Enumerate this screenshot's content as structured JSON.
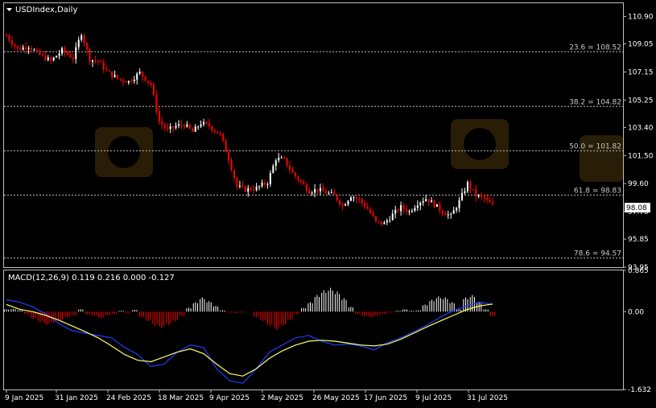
{
  "header": {
    "symbol_label": "USDIndex,Daily",
    "macd_label": "MACD(12,26,9) 0.119 0.216 0.000 -0.127"
  },
  "colors": {
    "background": "#000000",
    "frame": "#c0c0c0",
    "bull_candle": "#ffffff",
    "bear_candle": "#ff0000",
    "macd_pos_hist": "#ffffff",
    "macd_neg_hist": "#ff0000",
    "macd_line": "#1f3dff",
    "signal_line": "#ffff66",
    "fib_line": "#bdbdbd",
    "price_box_bg": "#ffffff",
    "price_box_text": "#000000"
  },
  "chart_data": [
    {
      "type": "candlestick",
      "title": "USDIndex,Daily",
      "price_axis_ticks": [
        "110.90",
        "109.05",
        "107.15",
        "105.25",
        "103.40",
        "101.50",
        "99.60",
        "97.70",
        "95.85",
        "93.95"
      ],
      "ylim": [
        93.95,
        111.8
      ],
      "current_price": "98.08",
      "x_tick_labels": [
        "9 Jan 2025",
        "31 Jan 2025",
        "24 Feb 2025",
        "18 Mar 2025",
        "9 Apr 2025",
        "2 May 2025",
        "26 May 2025",
        "17 Jun 2025",
        "9 Jul 2025",
        "31 Jul 2025"
      ],
      "fib_levels": [
        {
          "label": "23.6 = 108.52",
          "value": 108.52
        },
        {
          "label": "38.2 = 104.82",
          "value": 104.82
        },
        {
          "label": "50.0 = 101.82",
          "value": 101.82
        },
        {
          "label": "61.8 = 98.83",
          "value": 98.83
        },
        {
          "label": "78.6 = 94.57",
          "value": 94.57
        }
      ],
      "close_path": [
        [
          0,
          109.6
        ],
        [
          4,
          108.7
        ],
        [
          8,
          108.9
        ],
        [
          12,
          108.3
        ],
        [
          16,
          107.9
        ],
        [
          20,
          108.6
        ],
        [
          24,
          108.1
        ],
        [
          27,
          109.8
        ],
        [
          30,
          108.0
        ],
        [
          33,
          107.9
        ],
        [
          36,
          107.2
        ],
        [
          40,
          106.7
        ],
        [
          44,
          106.5
        ],
        [
          48,
          107.1
        ],
        [
          52,
          106.3
        ],
        [
          55,
          103.8
        ],
        [
          58,
          103.2
        ],
        [
          61,
          103.5
        ],
        [
          64,
          103.6
        ],
        [
          67,
          103.1
        ],
        [
          70,
          103.7
        ],
        [
          73,
          103.5
        ],
        [
          77,
          102.9
        ],
        [
          80,
          101.3
        ],
        [
          83,
          99.4
        ],
        [
          86,
          99.2
        ],
        [
          90,
          99.3
        ],
        [
          94,
          99.7
        ],
        [
          97,
          101.3
        ],
        [
          100,
          101.2
        ],
        [
          103,
          100.3
        ],
        [
          106,
          99.7
        ],
        [
          109,
          99.1
        ],
        [
          112,
          99.2
        ],
        [
          115,
          99.0
        ],
        [
          118,
          98.8
        ],
        [
          121,
          98.1
        ],
        [
          124,
          98.8
        ],
        [
          127,
          98.5
        ],
        [
          130,
          97.9
        ],
        [
          133,
          97.0
        ],
        [
          136,
          96.9
        ],
        [
          139,
          97.5
        ],
        [
          142,
          98.0
        ],
        [
          145,
          97.7
        ],
        [
          148,
          98.3
        ],
        [
          151,
          98.6
        ],
        [
          154,
          98.2
        ],
        [
          157,
          97.7
        ],
        [
          160,
          97.4
        ],
        [
          163,
          98.4
        ],
        [
          166,
          99.6
        ],
        [
          169,
          98.8
        ],
        [
          172,
          98.6
        ],
        [
          175,
          98.08
        ]
      ]
    },
    {
      "type": "histogram+line",
      "title": "MACD(12,26,9) 0.119 0.216 0.000 -0.127",
      "axis_ticks": [
        "0.865",
        "0.00",
        "-1.632"
      ],
      "ylim": [
        -1.632,
        0.865
      ],
      "histogram": [
        0.05,
        0.06,
        0.03,
        -0.05,
        -0.15,
        -0.22,
        -0.28,
        -0.24,
        -0.18,
        -0.12,
        -0.08,
        0.05,
        -0.06,
        -0.09,
        -0.14,
        -0.08,
        -0.05,
        0.02,
        -0.03,
        0.04,
        -0.12,
        -0.2,
        -0.3,
        -0.35,
        -0.28,
        -0.2,
        -0.1,
        0.08,
        0.2,
        0.3,
        0.22,
        0.12,
        0.03,
        -0.02,
        -0.03,
        -0.02,
        0.0,
        -0.12,
        -0.2,
        -0.3,
        -0.38,
        -0.3,
        -0.18,
        -0.05,
        0.08,
        0.2,
        0.35,
        0.45,
        0.5,
        0.42,
        0.28,
        0.1,
        -0.05,
        -0.1,
        -0.12,
        -0.08,
        -0.05,
        -0.02,
        0.02,
        0.05,
        0.02,
        0.03,
        0.15,
        0.25,
        0.32,
        0.3,
        0.2,
        0.05,
        0.3,
        0.35,
        0.2,
        0.05,
        -0.1
      ],
      "macd_line": [
        0.25,
        0.2,
        0.1,
        -0.05,
        -0.25,
        -0.4,
        -0.45,
        -0.5,
        -0.55,
        -0.75,
        -0.9,
        -1.15,
        -1.1,
        -0.85,
        -0.7,
        -0.75,
        -1.2,
        -1.45,
        -1.5,
        -1.2,
        -0.85,
        -0.7,
        -0.55,
        -0.5,
        -0.62,
        -0.7,
        -0.68,
        -0.72,
        -0.8,
        -0.65,
        -0.55,
        -0.42,
        -0.28,
        -0.12,
        0.02,
        0.12,
        0.2,
        0.15
      ],
      "signal_line": [
        0.15,
        0.05,
        0.0,
        -0.08,
        -0.18,
        -0.3,
        -0.42,
        -0.55,
        -0.72,
        -0.9,
        -1.02,
        -1.05,
        -0.95,
        -0.85,
        -0.78,
        -0.88,
        -1.1,
        -1.3,
        -1.35,
        -1.2,
        -0.98,
        -0.82,
        -0.7,
        -0.62,
        -0.6,
        -0.62,
        -0.66,
        -0.7,
        -0.72,
        -0.68,
        -0.58,
        -0.45,
        -0.32,
        -0.2,
        -0.08,
        0.04,
        0.12,
        0.16
      ]
    }
  ]
}
